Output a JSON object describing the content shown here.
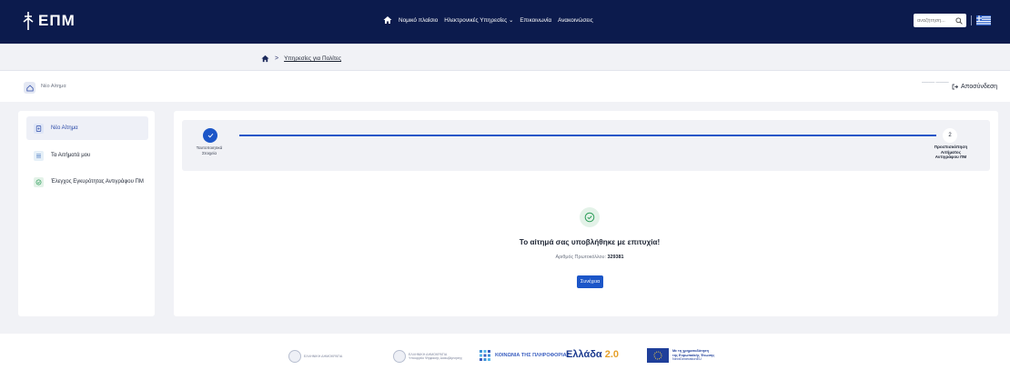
{
  "header": {
    "logo_text": "ΕΠΜ",
    "nav": [
      "Νομικό πλαίσιο",
      "Ηλεκτρονικές Υπηρεσίες",
      "Επικοινωνία",
      "Ανακοινώσεις"
    ],
    "search_placeholder": "αναζήτηση...",
    "icons": {
      "home": "home-icon",
      "search": "search-icon",
      "language": "greek-flag-icon"
    }
  },
  "breadcrumb": {
    "current": "Υπηρεσίες για Πολίτες",
    "separator": ">"
  },
  "subheader": {
    "title": "Νέο Αίτημα",
    "user": "──── ────",
    "logout": "Αποσύνδεση"
  },
  "sidebar": {
    "items": [
      {
        "label": "Νέο Αίτημα",
        "icon": "document-plus-icon",
        "active": true
      },
      {
        "label": "Τα Αιτήματά μου",
        "icon": "list-icon",
        "active": false
      },
      {
        "label": "Έλεγχος Εγκυρότητας Αντιγράφου ΠΜ",
        "icon": "check-circle-icon",
        "active": false
      }
    ]
  },
  "stepper": {
    "steps": [
      {
        "label": "Ταυτοποιητικά Στοιχεία",
        "state": "completed"
      },
      {
        "number": "2",
        "label": "Προεπισκόπηση Αιτήματος Αντιγράφου ΠΜ",
        "state": "current"
      }
    ]
  },
  "result": {
    "title": "Το αίτημά σας υποβλήθηκε με επιτυχία!",
    "protocol_label": "Αριθμός Πρωτοκόλλου: ",
    "protocol_number": "329381",
    "continue_label": "Συνέχεια"
  },
  "footer": {
    "logo1": "ΕΛΛΗΝΙΚΗ ΔΗΜΟΚΡΑΤΙΑ",
    "logo2_line1": "ΕΛΛΗΝΙΚΗ ΔΗΜΟΚΡΑΤΙΑ",
    "logo2_line2": "Υπουργείο Ψηφιακής Διακυβέρνησης",
    "koinonia": "ΚΟΙΝΩΝΙΑ ΤΗΣ ΠΛΗΡΟΦΟΡΙΑΣ",
    "ellada_main": "Ελλάδα",
    "ellada_version": "2.0",
    "eu_line1": "Με τη χρηματοδότηση",
    "eu_line2": "της Ευρωπαϊκής Ένωσης",
    "eu_line3": "NextGenerationEU"
  },
  "colors": {
    "navy": "#0c1b4d",
    "primary": "#1c56c8",
    "success": "#2e9e5a"
  }
}
